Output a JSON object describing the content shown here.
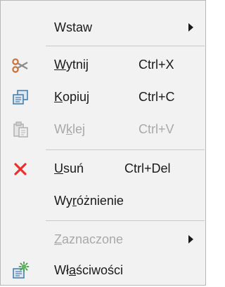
{
  "menu": {
    "items": [
      {
        "id": "wstaw",
        "pre": "Wstaw",
        "mn": "",
        "post": "",
        "shortcut": "",
        "submenu": true,
        "enabled": true,
        "icon": ""
      },
      {
        "id": "wytnij",
        "pre": "",
        "mn": "W",
        "post": "ytnij",
        "shortcut": "Ctrl+X",
        "submenu": false,
        "enabled": true,
        "icon": "scissors-icon"
      },
      {
        "id": "kopiuj",
        "pre": "",
        "mn": "K",
        "post": "opiuj",
        "shortcut": "Ctrl+C",
        "submenu": false,
        "enabled": true,
        "icon": "copy-icon"
      },
      {
        "id": "wklej",
        "pre": "W",
        "mn": "k",
        "post": "lej",
        "shortcut": "Ctrl+V",
        "submenu": false,
        "enabled": false,
        "icon": "paste-icon"
      },
      {
        "id": "usun",
        "pre": "",
        "mn": "U",
        "post": "suń",
        "shortcut": "Ctrl+Del",
        "submenu": false,
        "enabled": true,
        "icon": "delete-x-icon"
      },
      {
        "id": "wyroznienie",
        "pre": "Wy",
        "mn": "r",
        "post": "óżnienie",
        "shortcut": "",
        "submenu": false,
        "enabled": true,
        "icon": ""
      },
      {
        "id": "zaznaczone",
        "pre": "",
        "mn": "Z",
        "post": "aznaczone",
        "shortcut": "",
        "submenu": true,
        "enabled": false,
        "icon": ""
      },
      {
        "id": "wlasciwosci",
        "pre": "Wł",
        "mn": "a",
        "post": "ściwości",
        "shortcut": "",
        "submenu": false,
        "enabled": true,
        "icon": "properties-icon"
      }
    ]
  },
  "colors": {
    "menu_background": "#f2f2f2",
    "disabled_text": "#a9a9a9",
    "delete_icon": "#e8312f",
    "scissors_icon": "#c9733a",
    "copy_icon": "#4e7fa8"
  }
}
